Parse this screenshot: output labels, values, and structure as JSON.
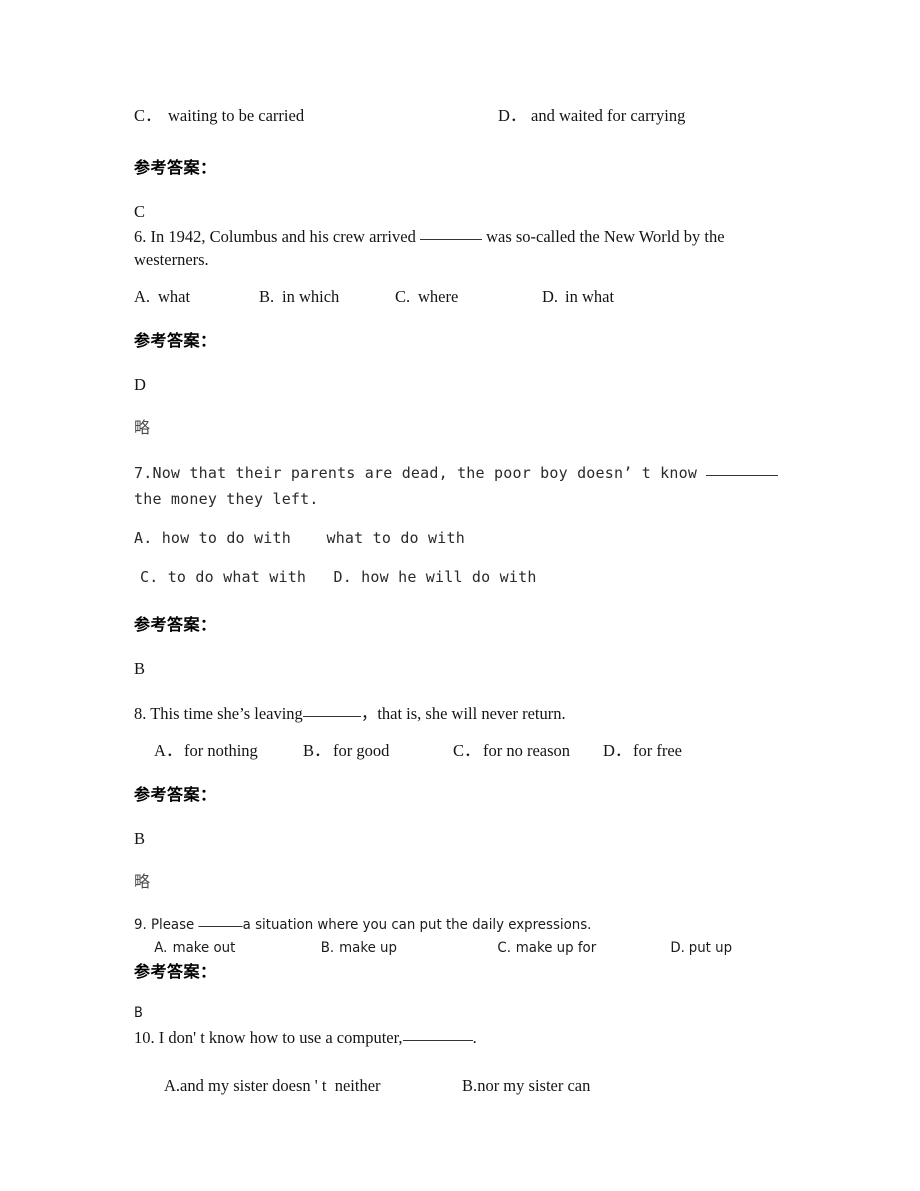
{
  "document": {
    "labels": {
      "reference_answer": "参考答案：",
      "omitted": "略"
    },
    "blocks": [
      {
        "id": "q5-options-tail",
        "options": [
          {
            "label": "C．",
            "text": "waiting to be carried"
          },
          {
            "label": "D．",
            "text": "and waited for carrying"
          }
        ]
      },
      {
        "id": "q5-answer",
        "answer": "C"
      },
      {
        "id": "q6",
        "stem_part1": "6. In 1942, Columbus and his crew arrived ",
        "stem_part2": " was so-called the New World by the westerners.",
        "options": [
          {
            "label": "A.",
            "text": "what"
          },
          {
            "label": "B.",
            "text": "in which"
          },
          {
            "label": "C.",
            "text": "where"
          },
          {
            "label": "D.",
            "text": "in what"
          }
        ],
        "answer": "D",
        "omitted": "略"
      },
      {
        "id": "q7",
        "stem_part1": "7.Now that their parents are dead, the poor boy doesn’ t know ",
        "stem_part2": "the money they left.",
        "options_line1": [
          {
            "label": "A.",
            "text": " how to do with"
          },
          {
            "label": "",
            "text": "what to do with"
          }
        ],
        "options_line2": [
          {
            "label": "C.",
            "text": " to do what with"
          },
          {
            "label": "D.",
            "text": " how he will do with"
          }
        ],
        "answer": "B"
      },
      {
        "id": "q8",
        "stem_part1": "8. This time she’s leaving",
        "stem_part2": "，that is, she will never return.",
        "options": [
          {
            "label": "A．",
            "text": "for nothing"
          },
          {
            "label": "B．",
            "text": "for good"
          },
          {
            "label": "C．",
            "text": "for no reason"
          },
          {
            "label": "D．",
            "text": "for free"
          }
        ],
        "answer": "B",
        "omitted": "略"
      },
      {
        "id": "q9",
        "stem_part1": "9. Please ",
        "stem_part2": "a situation where you can put the daily expressions.",
        "options": [
          {
            "label": "A.",
            "text": "make out"
          },
          {
            "label": "B.",
            "text": "make up"
          },
          {
            "label": "C.",
            "text": "make up for"
          },
          {
            "label": "D.",
            "text": "put up"
          }
        ],
        "answer": "B"
      },
      {
        "id": "q10",
        "stem_part1": "10. I don' t know how to use a computer,",
        "stem_part2": ".",
        "options": [
          {
            "label": "A.",
            "text": "and my sister doesn ' t  neither"
          },
          {
            "label": "B.",
            "text": "nor my sister can"
          }
        ]
      }
    ]
  }
}
